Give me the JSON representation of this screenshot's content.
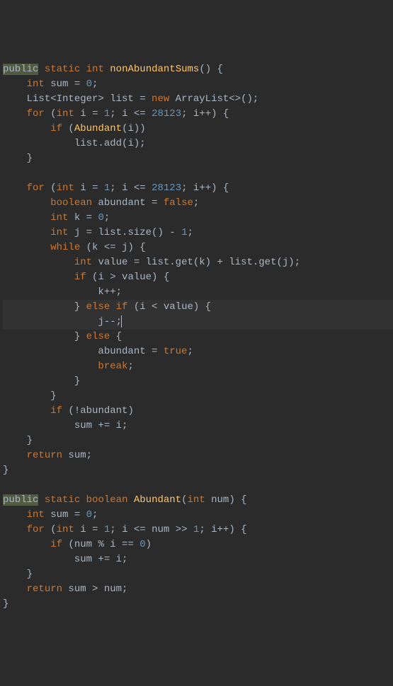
{
  "code": {
    "l1": {
      "kw1": "public",
      "kw2": "static",
      "kw3": "int",
      "fn": "nonAbundantSums",
      "p": "() {"
    },
    "l2": {
      "kw": "int",
      "var": " sum = ",
      "num": "0",
      "p": ";"
    },
    "l3": {
      "t1": "List<Integer> list = ",
      "kw": "new",
      "t2": " ArrayList<>();"
    },
    "l4": {
      "kw1": "for",
      "p1": " (",
      "kw2": "int",
      "t1": " i = ",
      "n1": "1",
      "t2": "; i <= ",
      "n2": "28123",
      "t3": "; i++) {"
    },
    "l5": {
      "kw": "if",
      "p1": " (",
      "fn": "Abundant",
      "p2": "(i))"
    },
    "l6": {
      "t": "list.add(i);"
    },
    "l7": {
      "p": "}"
    },
    "l8": {
      "kw1": "for",
      "p1": " (",
      "kw2": "int",
      "t1": " i = ",
      "n1": "1",
      "t2": "; i <= ",
      "n2": "28123",
      "t3": "; i++) {"
    },
    "l9": {
      "kw1": "boolean",
      "t": " abundant = ",
      "kw2": "false",
      "p": ";"
    },
    "l10": {
      "kw": "int",
      "t": " k = ",
      "n": "0",
      "p": ";"
    },
    "l11": {
      "kw": "int",
      "t1": " j = list.size() - ",
      "n": "1",
      "p": ";"
    },
    "l12": {
      "kw": "while",
      "t": " (k <= j) {"
    },
    "l13": {
      "kw": "int",
      "t": " value = list.get(k) + list.get(j);"
    },
    "l14": {
      "kw": "if",
      "t": " (i > value) {"
    },
    "l15": {
      "t": "k++;"
    },
    "l16": {
      "p1": "} ",
      "kw1": "else if",
      "t": " (i < value) {"
    },
    "l17": {
      "t": "j--;"
    },
    "l18": {
      "p": "} ",
      "kw": "else",
      "p2": " {"
    },
    "l19": {
      "t1": "abundant = ",
      "kw": "true",
      "p": ";"
    },
    "l20": {
      "kw": "break",
      "p": ";"
    },
    "l21": {
      "p": "}"
    },
    "l22": {
      "p": "}"
    },
    "l23": {
      "kw": "if",
      "t": " (!abundant)"
    },
    "l24": {
      "t": "sum += i;"
    },
    "l25": {
      "p": "}"
    },
    "l26": {
      "kw": "return",
      "t": " sum;"
    },
    "l27": {
      "p": "}"
    },
    "l28": {
      "kw1": "public",
      "kw2": "static",
      "kw3": "boolean",
      "fn": "Abundant",
      "p1": "(",
      "kw4": "int",
      "t": " num) {"
    },
    "l29": {
      "kw": "int",
      "t": " sum = ",
      "n": "0",
      "p": ";"
    },
    "l30": {
      "kw1": "for",
      "p1": " (",
      "kw2": "int",
      "t1": " i = ",
      "n1": "1",
      "t2": "; i <= num >> ",
      "n2": "1",
      "t3": "; i++) {"
    },
    "l31": {
      "kw": "if",
      "t1": " (num % i == ",
      "n": "0",
      "t2": ")"
    },
    "l32": {
      "t": "sum += i;"
    },
    "l33": {
      "p": "}"
    },
    "l34": {
      "kw": "return",
      "t": " sum > num;"
    },
    "l35": {
      "p": "}"
    }
  }
}
